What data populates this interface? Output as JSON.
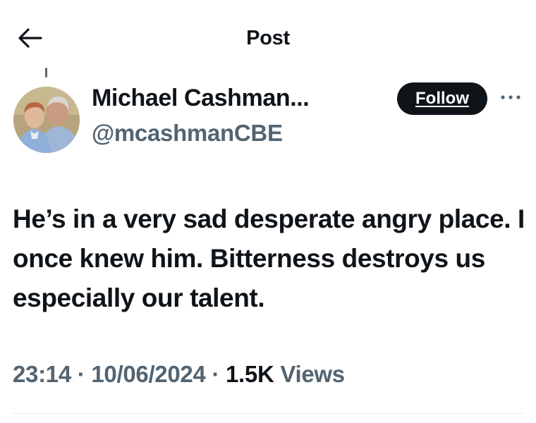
{
  "header": {
    "back_icon": "arrow-left-icon",
    "title": "Post"
  },
  "author": {
    "display_name": "Michael Cashman...",
    "handle": "@mcashmanCBE",
    "follow_label": "Follow",
    "more_icon": "more-horizontal-icon"
  },
  "post": {
    "text": "He’s in a very sad desperate angry place. I once knew him. Bitterness destroys us especially our talent.",
    "time": "23:14",
    "separator": "·",
    "date": "10/06/2024",
    "views_count": "1.5K",
    "views_label": "Views"
  },
  "colors": {
    "text_primary": "#0f1419",
    "text_secondary": "#536471",
    "button_bg": "#0f1419",
    "divider": "#e6e9eb"
  }
}
